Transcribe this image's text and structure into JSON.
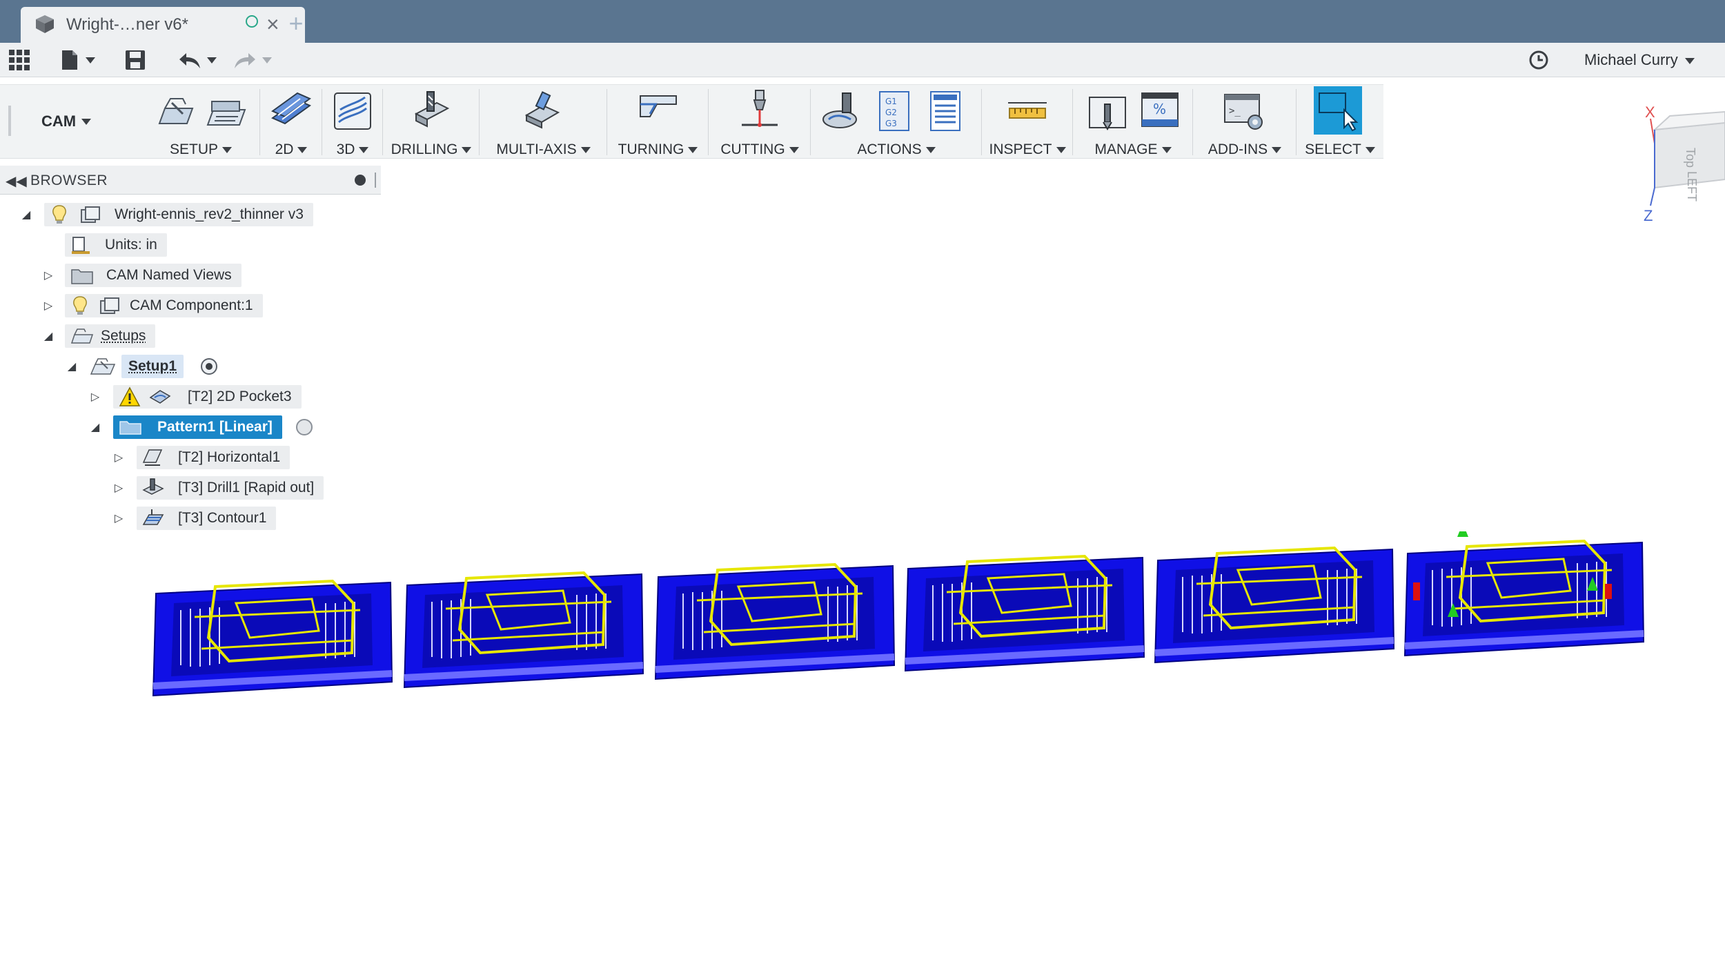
{
  "document_tab": {
    "title": "Wright-…ner v6*",
    "close_symbol": "×",
    "new_tab_symbol": "+",
    "icon": "cube-icon"
  },
  "quick_access": {
    "user_name": "Michael Curry",
    "icons": [
      "app-grid-icon",
      "file-icon",
      "save-icon",
      "undo-icon",
      "redo-icon",
      "job-status-clock-icon"
    ]
  },
  "ribbon": {
    "workspace_label": "CAM",
    "groups": [
      {
        "label": "SETUP"
      },
      {
        "label": "2D"
      },
      {
        "label": "3D"
      },
      {
        "label": "DRILLING"
      },
      {
        "label": "MULTI-AXIS"
      },
      {
        "label": "TURNING"
      },
      {
        "label": "CUTTING"
      },
      {
        "label": "ACTIONS"
      },
      {
        "label": "INSPECT"
      },
      {
        "label": "MANAGE"
      },
      {
        "label": "ADD-INS"
      },
      {
        "label": "SELECT"
      }
    ],
    "actions_gcode_text": [
      "G1",
      "G2",
      "G3"
    ],
    "manage_percent_symbol": "%",
    "addins_prompt_symbol": ">_"
  },
  "browser": {
    "title": "BROWSER",
    "nodes": [
      {
        "label": "Wright-ennis_rev2_thinner v3"
      },
      {
        "label": "Units: in"
      },
      {
        "label": "CAM Named Views"
      },
      {
        "label": "CAM Component:1"
      },
      {
        "label": "Setups"
      },
      {
        "label": "Setup1"
      },
      {
        "label": "[T2] 2D Pocket3"
      },
      {
        "label": "Pattern1 [Linear]"
      },
      {
        "label": "[T2] Horizontal1"
      },
      {
        "label": "[T3] Drill1 [Rapid out]"
      },
      {
        "label": "[T3] Contour1"
      }
    ]
  },
  "viewcube": {
    "face_left": "LEFT",
    "face_top": "Top",
    "axis_x": "X",
    "axis_z": "Z"
  },
  "colors": {
    "tabbar_bg": "#5a7590",
    "stock_blue": "#1010e6",
    "toolpath_yellow": "#e6e600",
    "selection_blue": "#1a86c8",
    "select_button": "#1c9ad6"
  },
  "viewport": {
    "pattern_instances": 6
  }
}
